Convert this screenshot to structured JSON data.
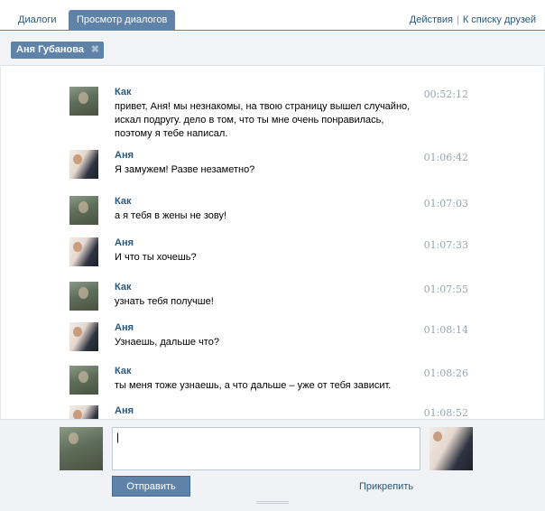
{
  "tabs": [
    {
      "label": "Диалоги"
    },
    {
      "label": "Просмотр диалогов"
    }
  ],
  "top_links": {
    "actions": "Действия",
    "separator": "|",
    "friends": "К списку друзей"
  },
  "filter": {
    "chip_label": "Аня Губанова",
    "remove": "✖"
  },
  "messages": [
    {
      "author": "Как",
      "text": "привет, Аня! мы незнакомы, на твою страницу вышел случайно, искал подругу. дело в том, что ты мне очень понравилась, поэтому я тебе написал.",
      "time": "00:52:12"
    },
    {
      "author": "Аня",
      "text": "Я замужем! Разве незаметно?",
      "time": "01:06:42"
    },
    {
      "author": "Как",
      "text": "а я тебя в жены не зову!",
      "time": "01:07:03"
    },
    {
      "author": "Аня",
      "text": "И что ты хочешь?",
      "time": "01:07:33"
    },
    {
      "author": "Как",
      "text": "узнать тебя получше!",
      "time": "01:07:55"
    },
    {
      "author": "Аня",
      "text": "Узнаешь, дальше что?",
      "time": "01:08:14"
    },
    {
      "author": "Как",
      "text": "ты меня тоже узнаешь, а что дальше – уже от тебя зависит.",
      "time": "01:08:26"
    },
    {
      "author": "Аня",
      "text": "",
      "time": "01:08:52"
    }
  ],
  "compose": {
    "input_value": "|",
    "send_label": "Отправить",
    "attach_label": "Прикрепить"
  },
  "colors": {
    "accent": "#5e82a8",
    "link": "#2b587a",
    "time": "#99a4b0"
  }
}
